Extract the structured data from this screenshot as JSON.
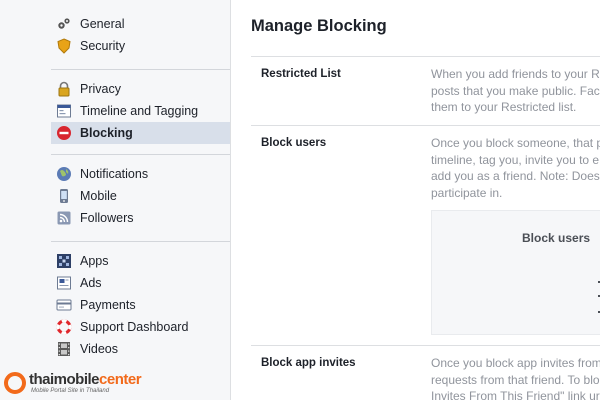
{
  "sidebar": {
    "groups": [
      {
        "items": [
          {
            "label": "General",
            "icon": "gears-icon"
          },
          {
            "label": "Security",
            "icon": "badge-icon"
          }
        ]
      },
      {
        "items": [
          {
            "label": "Privacy",
            "icon": "lock-icon"
          },
          {
            "label": "Timeline and Tagging",
            "icon": "timeline-icon"
          },
          {
            "label": "Blocking",
            "icon": "no-entry-icon",
            "active": true
          }
        ]
      },
      {
        "items": [
          {
            "label": "Notifications",
            "icon": "globe-icon"
          },
          {
            "label": "Mobile",
            "icon": "phone-icon"
          },
          {
            "label": "Followers",
            "icon": "rss-icon"
          }
        ]
      },
      {
        "items": [
          {
            "label": "Apps",
            "icon": "apps-grid-icon"
          },
          {
            "label": "Ads",
            "icon": "ads-icon"
          },
          {
            "label": "Payments",
            "icon": "card-icon"
          },
          {
            "label": "Support Dashboard",
            "icon": "lifebuoy-icon"
          },
          {
            "label": "Videos",
            "icon": "film-icon"
          }
        ]
      }
    ]
  },
  "main": {
    "title": "Manage Blocking",
    "sections": [
      {
        "label": "Restricted List",
        "description_lines": [
          "When you add friends to your R",
          "posts that you make public. Fac",
          "them to your Restricted list."
        ]
      },
      {
        "label": "Block users",
        "description_lines": [
          "Once you block someone, that p",
          "timeline, tag you, invite you to e",
          "add you as a friend. Note: Does",
          "participate in."
        ],
        "panel_title": "Block users"
      },
      {
        "label": "Block app invites",
        "description_lines": [
          "Once you block app invites from",
          "requests from that friend. To blo",
          "Invites From This Friend\" link ur"
        ]
      }
    ]
  },
  "watermark": {
    "brand_main": "thaimobile",
    "brand_accent": "center",
    "tagline": "Mobile Portal Site in Thailand"
  },
  "colors": {
    "sidebar_bg": "#f6f7f9",
    "active_bg": "#d8dfea",
    "muted_text": "#90949c",
    "watermark_orange": "#f26a1b"
  }
}
